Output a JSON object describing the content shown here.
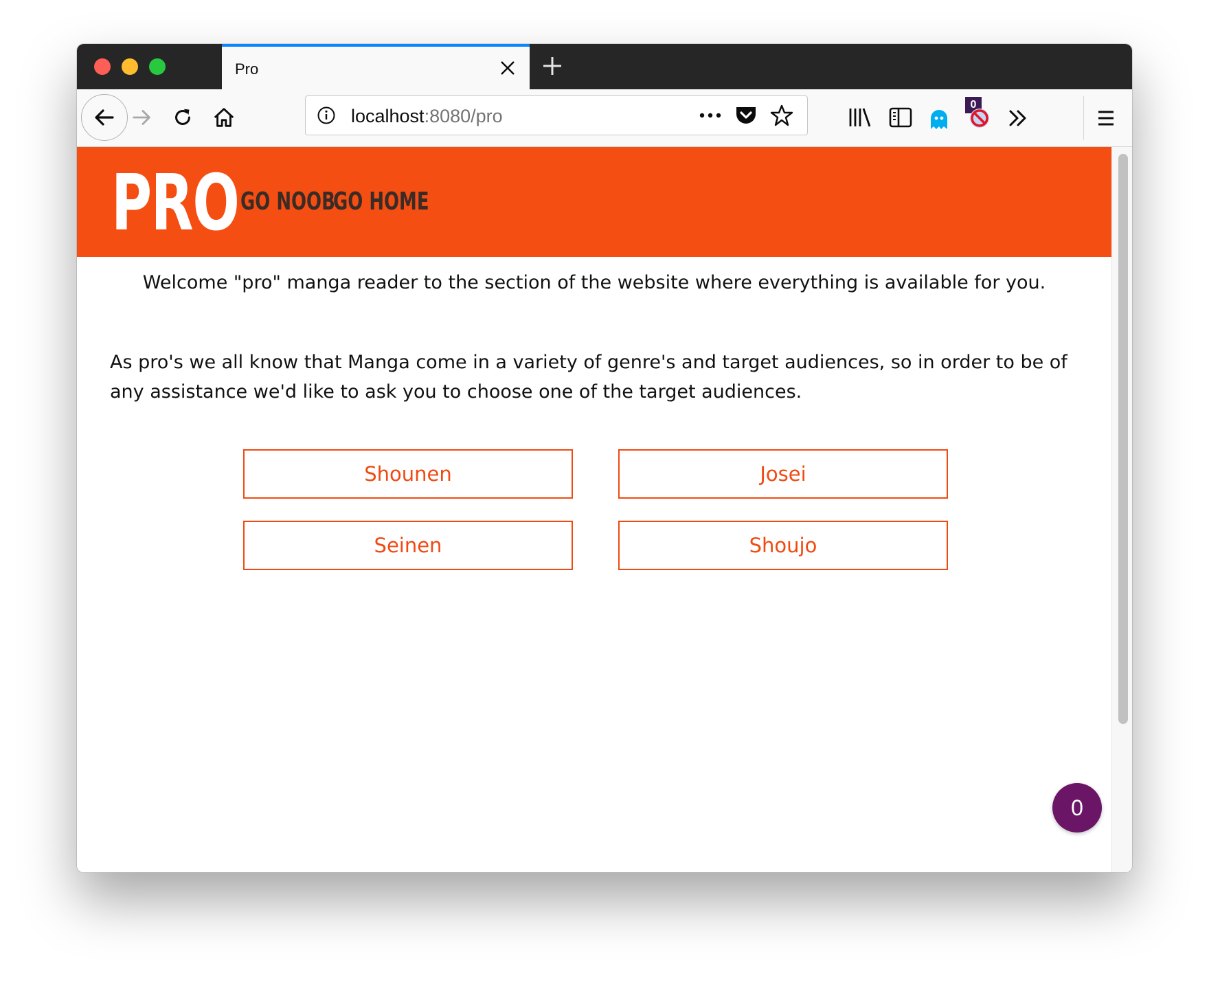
{
  "browser": {
    "tab_title": "Pro",
    "url_host": "localhost",
    "url_rest": ":8080/pro",
    "extension_badge_count": "0"
  },
  "icons": {
    "back": "back-arrow-icon",
    "forward": "forward-arrow-icon",
    "reload": "reload-icon",
    "home": "home-icon",
    "site_info": "info-icon",
    "page_actions": "more-horizontal-icon",
    "pocket": "pocket-icon",
    "bookmark": "star-icon",
    "library": "library-icon",
    "sidebar": "sidebar-icon",
    "ghostery": "ghost-icon",
    "blocker": "block-icon",
    "overflow": "chevron-double-right-icon",
    "menu": "hamburger-menu-icon"
  },
  "site": {
    "logo": "PRO",
    "nav": [
      "GO NOOB",
      "GO HOME"
    ],
    "welcome": "Welcome \"pro\" manga reader to the section of the website where everything is available for you.",
    "intro": "As pro's we all know that Manga come in a variety of genre's and target audiences, so in order to be of any assistance we'd like to ask you to choose one of the target audiences.",
    "audiences": [
      "Shounen",
      "Josei",
      "Seinen",
      "Shoujo"
    ],
    "fab_count": "0"
  },
  "colors": {
    "brand": "#f54e12",
    "accent_button": "#f04a12",
    "nav_text": "#3b2b26",
    "fab": "#6a1566",
    "tab_highlight": "#0a84ff"
  }
}
